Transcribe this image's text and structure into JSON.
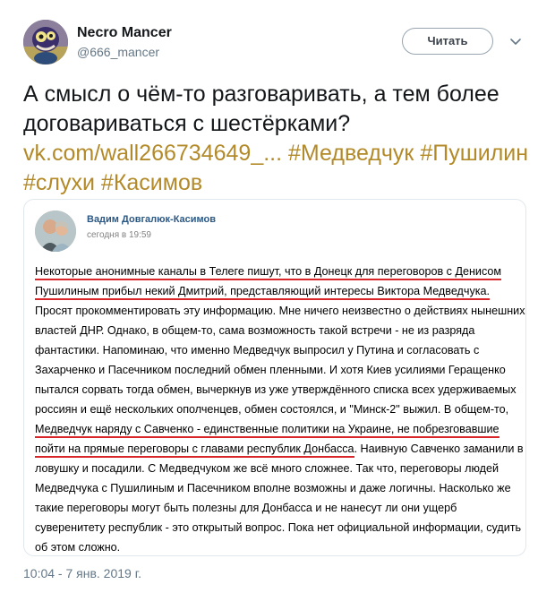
{
  "author": {
    "name": "Necro Mancer",
    "handle": "@666_mancer"
  },
  "follow_label": "Читать",
  "tweet": {
    "text_plain": "А смысл о чём-то разговаривать, а тем более договариваться с шестёрками?",
    "link": "vk.com/wall266734649_...",
    "hashtags": [
      "#Медведчук",
      "#Пушилин",
      "#слухи",
      "#Касимов"
    ]
  },
  "vk_post": {
    "author": "Вадим Довгалюк-Касимов",
    "time": "сегодня в 19:59",
    "segments": [
      {
        "text": "Некоторые анонимные каналы в Телеге пишут, что в Донецк для переговоров с Денисом Пушилиным прибыл некий Дмитрий, представляющий интересы Виктора Медведчука.",
        "underline": true
      },
      {
        "text": " Просят прокомментировать эту информацию. Мне ничего неизвестно о действиях нынешних властей ДНР. Однако, в общем-то, сама возможность такой встречи - не из разряда фантастики. Напоминаю, что именно Медведчук выпросил у Путина и согласовать с Захарченко и Пасечником последний обмен пленными. И хотя Киев усилиями Геращенко пытался сорвать тогда обмен, вычеркнув из уже утверждённого списка всех удерживаемых россиян и ещё нескольких ополченцев, обмен состоялся, и \"Минск-2\" выжил. В общем-то, ",
        "underline": false
      },
      {
        "text": "Медведчук наряду с Савченко - единственные политики на Украине, не побрезговавшие пойти на прямые переговоры с главами республик Донбасса",
        "underline": true
      },
      {
        "text": ". Наивную Савченко заманили в ловушку и посадили. С Медведчуком же всё много сложнее. Так что, переговоры людей Медведчука с Пушилиным и Пасечником вполне возможны и даже логичны. Насколько же такие переговоры могут быть полезны для Донбасса и не нанесут ли они ущерб суверенитету республик - это открытый вопрос. Пока нет официальной информации, судить об этом сложно.",
        "underline": false
      }
    ]
  },
  "timestamp": "10:04 - 7 янв. 2019 г.",
  "colors": {
    "link": "#b38a2a",
    "vk_name": "#2a5885",
    "underline": "#d9262b",
    "muted": "#657786"
  },
  "icons": {
    "avatar": "cartoon-monster-avatar",
    "menu": "chevron-down-icon"
  }
}
